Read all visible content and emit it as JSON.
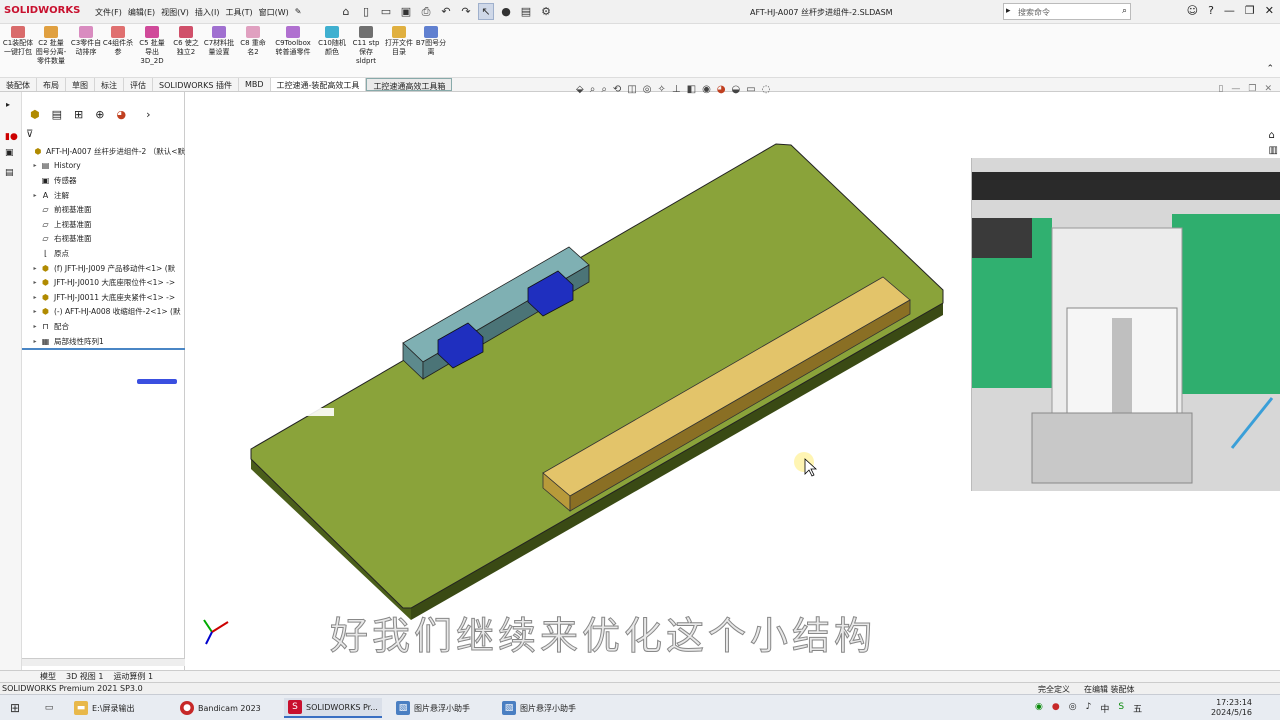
{
  "app": {
    "logo": "SOLIDWORKS",
    "doc_title": "AFT-HJ-A007 丝杆步进组件-2.SLDASM"
  },
  "menu": [
    "文件(F)",
    "编辑(E)",
    "视图(V)",
    "插入(I)",
    "工具(T)",
    "窗口(W)"
  ],
  "search": {
    "placeholder": "搜索命令"
  },
  "ribbon": [
    {
      "label": "C1装配体一键打包",
      "color": "#d96b6b"
    },
    {
      "label": "C2 批量图号分离-零件数量",
      "color": "#e0a040"
    },
    {
      "label": "C3零件自动排序",
      "color": "#d98cc0"
    },
    {
      "label": "C4组件杀参",
      "color": "#e07070"
    },
    {
      "label": "C5 批量导出 3D_2D",
      "color": "#d04a9a"
    },
    {
      "label": "C6 使之独立2",
      "color": "#d0506a"
    },
    {
      "label": "C7材料批量设置",
      "color": "#a070d0"
    },
    {
      "label": "C8 重命名2",
      "color": "#e0a0c0"
    },
    {
      "label": "C9Toolbox 转普通零件",
      "color": "#b070d0"
    },
    {
      "label": "C10随机颜色",
      "color": "#40b0d0"
    },
    {
      "label": "C11 stp保存 sldprt",
      "color": "#707070"
    },
    {
      "label": "打开文件目录",
      "color": "#e0b040"
    },
    {
      "label": "B7图号分离",
      "color": "#6080d0"
    }
  ],
  "tabs": [
    "装配体",
    "布局",
    "草图",
    "标注",
    "评估",
    "SOLIDWORKS 插件",
    "MBD",
    "工控速通-装配高效工具",
    "工控速通高效工具箱"
  ],
  "active_tab": "工控速通-装配高效工具",
  "tree": [
    {
      "label": "AFT-HJ-A007 丝杆步进组件-2 （默认<默",
      "icon": "asm",
      "arrow": ""
    },
    {
      "label": "History",
      "icon": "hist",
      "arrow": "▸"
    },
    {
      "label": "传感器",
      "icon": "sens",
      "arrow": ""
    },
    {
      "label": "注解",
      "icon": "ann",
      "arrow": "▸"
    },
    {
      "label": "前视基准面",
      "icon": "plane",
      "arrow": ""
    },
    {
      "label": "上视基准面",
      "icon": "plane",
      "arrow": ""
    },
    {
      "label": "右视基准面",
      "icon": "plane",
      "arrow": ""
    },
    {
      "label": "原点",
      "icon": "origin",
      "arrow": ""
    },
    {
      "label": "(f) JFT-HJ-J009 产品移动件<1> (默",
      "icon": "part",
      "arrow": "▸"
    },
    {
      "label": "JFT-HJ-J0010 大底座限位件<1> ->",
      "icon": "part",
      "arrow": "▸"
    },
    {
      "label": "JFT-HJ-J0011 大底座夹紧件<1> ->",
      "icon": "part",
      "arrow": "▸"
    },
    {
      "label": "(-) AFT-HJ-A008 收缩组件-2<1> (默",
      "icon": "part",
      "arrow": "▸"
    },
    {
      "label": "配合",
      "icon": "mate",
      "arrow": "▸"
    },
    {
      "label": "局部线性阵列1",
      "icon": "pattern",
      "arrow": "▸"
    }
  ],
  "subtitle": "好我们继续来优化这个小结构",
  "bottom_tabs": [
    "模型",
    "3D 视图 1",
    "运动算例 1"
  ],
  "status": {
    "left": "SOLIDWORKS Premium 2021 SP3.0",
    "right": [
      "完全定义",
      "在编辑 装配体"
    ]
  },
  "taskbar": [
    {
      "label": "E:\\屏录输出",
      "color": "#e8b84a"
    },
    {
      "label": "Bandicam 2023",
      "color": "#c62828"
    },
    {
      "label": "SOLIDWORKS Pr...",
      "color": "#c8102e"
    },
    {
      "label": "图片悬浮小助手",
      "color": "#4a7fc2"
    },
    {
      "label": "图片悬浮小助手",
      "color": "#4a7fc2"
    }
  ],
  "clock": {
    "time": "17:23:14",
    "date": "2024/5/16"
  },
  "tray": [
    "中",
    "五"
  ],
  "colors": {
    "plate": "#8aa33a",
    "plate_side": "#3a4a14",
    "rail": "#e3c46a",
    "block": "#6f9fa2",
    "clamp": "#1f2fbf"
  }
}
